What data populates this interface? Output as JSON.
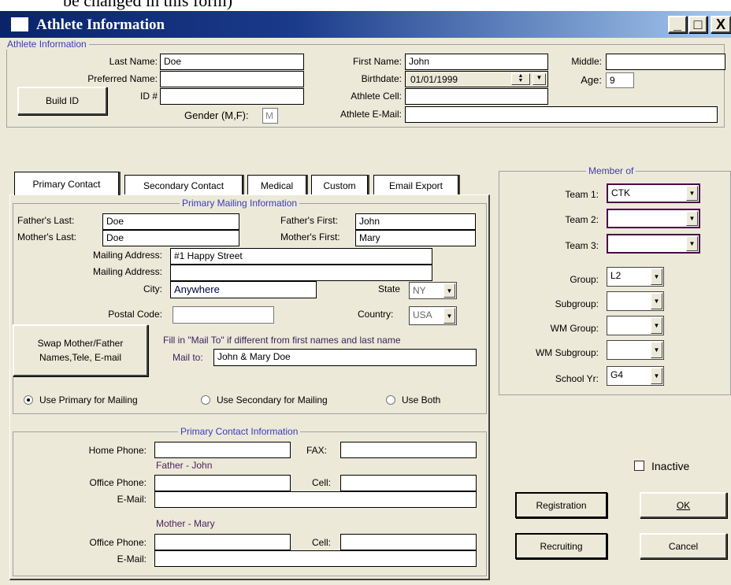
{
  "top_fragment": "be changed in this form)",
  "window": {
    "title": "Athlete Information",
    "title_color": "#0a246a",
    "minimize_label": "_",
    "maximize_label": "□",
    "close_label": "X"
  },
  "athlete": {
    "group_title": "Athlete Information",
    "last_name_label": "Last Name:",
    "last_name": "Doe",
    "preferred_name_label": "Preferred Name:",
    "preferred_name": "",
    "id_label": "ID #",
    "id_value": "",
    "build_id_label": "Build ID",
    "gender_label": "Gender (M,F):",
    "gender_value": "M",
    "first_name_label": "First Name:",
    "first_name": "John",
    "birthdate_label": "Birthdate:",
    "birthdate": "01/01/1999",
    "cell_label": "Athlete Cell:",
    "cell_value": "",
    "email_label": "Athlete E-Mail:",
    "email_value": "",
    "middle_label": "Middle:",
    "middle_value": "",
    "age_label": "Age:",
    "age_value": "9"
  },
  "tabs": [
    {
      "label": "Primary Contact",
      "accel": "P"
    },
    {
      "label": "Secondary Contact",
      "accel": "S"
    },
    {
      "label": "Medical",
      "accel": "M"
    },
    {
      "label": "Custom"
    },
    {
      "label": "Email Export"
    }
  ],
  "mailing": {
    "group_title": "Primary Mailing Information",
    "fathers_last_label": "Father's Last:",
    "fathers_last": "Doe",
    "fathers_first_label": "Father's First:",
    "fathers_first": "John",
    "mothers_last_label": "Mother's Last:",
    "mothers_last": "Doe",
    "mothers_first_label": "Mother's First:",
    "mothers_first": "Mary",
    "address1_label": "Mailing Address:",
    "address1": "#1 Happy Street",
    "address2_label": "Mailing Address:",
    "address2": "",
    "city_label": "City:",
    "city": "Anywhere",
    "state_label": "State",
    "state": "NY",
    "postal_label": "Postal Code:",
    "postal": "",
    "country_label": "Country:",
    "country": "USA",
    "swap_button": "Swap Mother/Father Names,Tele, E-mail",
    "hint": "Fill in \"Mail To\" if different from first names and last name",
    "mail_to_label": "Mail to:",
    "mail_to": "John & Mary Doe",
    "radio_primary": "Use Primary for Mailing",
    "radio_secondary": "Use Secondary for Mailing",
    "radio_both": "Use Both"
  },
  "contact": {
    "group_title": "Primary Contact Information",
    "home_phone_label": "Home Phone:",
    "home_phone": "",
    "fax_label": "FAX:",
    "fax": "",
    "father_heading": "Father - John",
    "father_office_label": "Office Phone:",
    "father_office": "",
    "father_cell_label": "Cell:",
    "father_cell": "",
    "father_email_label": "E-Mail:",
    "father_email": "",
    "mother_heading": "Mother - Mary",
    "mother_office_label": "Office Phone:",
    "mother_office": "",
    "mother_cell_label": "Cell:",
    "mother_cell": "",
    "mother_email_label": "E-Mail:",
    "mother_email": ""
  },
  "member_of": {
    "group_title": "Member of",
    "team1_label": "Team 1:",
    "team1": "CTK",
    "team2_label": "Team 2:",
    "team2": "",
    "team3_label": "Team 3:",
    "team3": "",
    "group_label": "Group:",
    "group": "L2",
    "subgroup_label": "Subgroup:",
    "subgroup": "",
    "wm_group_label": "WM Group:",
    "wm_group": "",
    "wm_subgroup_label": "WM Subgroup:",
    "wm_subgroup": "",
    "school_yr_label": "School Yr:",
    "school_yr": "G4"
  },
  "inactive_label": "Inactive",
  "buttons": {
    "registration": "Registration",
    "ok": "OK",
    "recruiting": "Recruiting",
    "cancel": "Cancel"
  }
}
